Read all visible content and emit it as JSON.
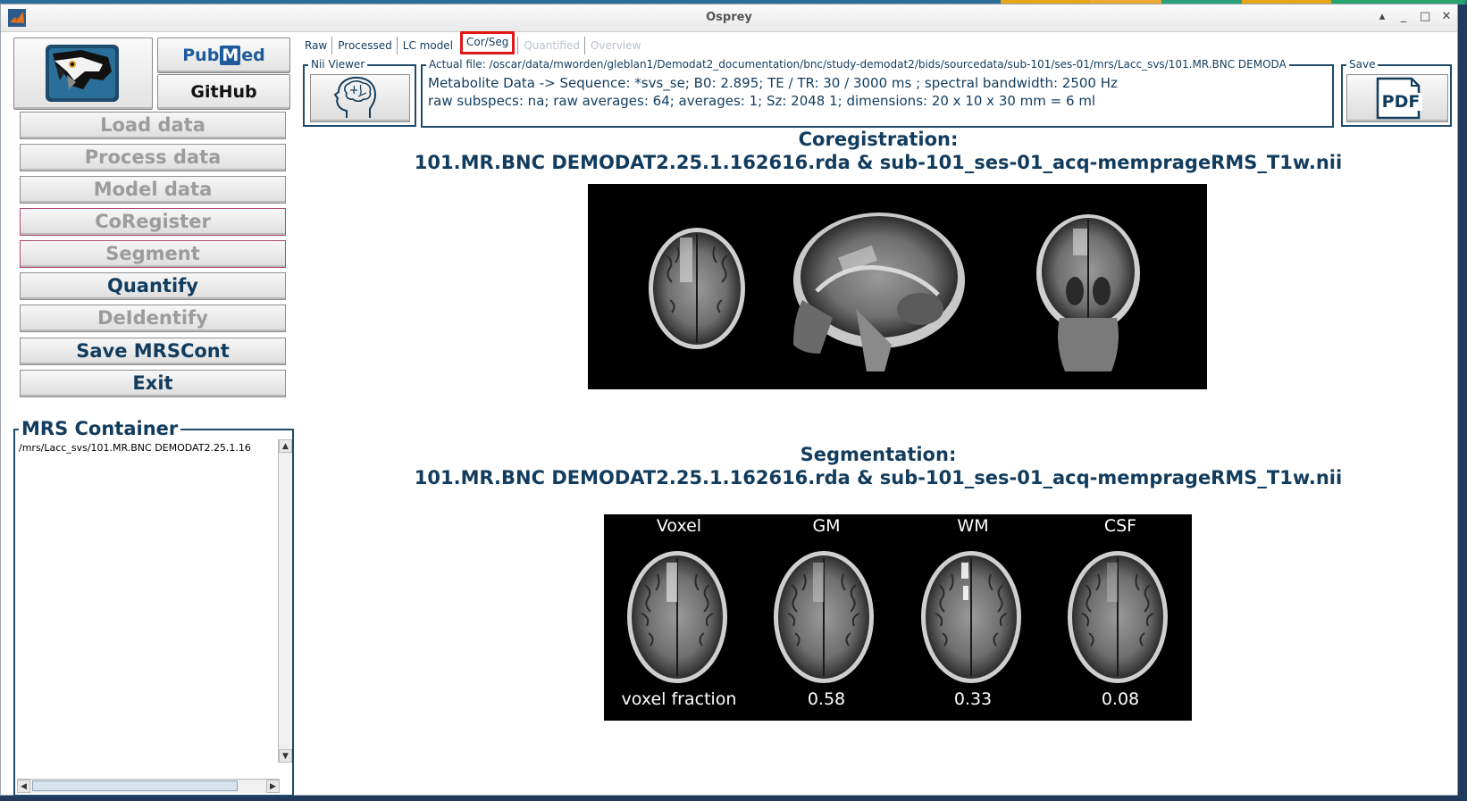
{
  "window": {
    "title": "Osprey",
    "controls": [
      "▴",
      "_",
      "□",
      "✕"
    ]
  },
  "links": {
    "pubmed_pre": "Pub",
    "pubmed_box": "M",
    "pubmed_post": "ed",
    "github": "GitHub"
  },
  "sidebar": {
    "buttons": [
      {
        "label": "Load data",
        "state": "disabled"
      },
      {
        "label": "Process data",
        "state": "disabled"
      },
      {
        "label": "Model data",
        "state": "disabled"
      },
      {
        "label": "CoRegister",
        "state": "disabled"
      },
      {
        "label": "Segment",
        "state": "disabled"
      },
      {
        "label": "Quantify",
        "state": "enabled"
      },
      {
        "label": "DeIdentify",
        "state": "disabled"
      },
      {
        "label": "Save MRSCont",
        "state": "enabled"
      },
      {
        "label": "Exit",
        "state": "enabled"
      }
    ],
    "mrs_container": {
      "title": "MRS Container",
      "items": [
        "/mrs/Lacc_svs/101.MR.BNC DEMODAT2.25.1.16"
      ]
    }
  },
  "tabs": [
    {
      "label": "Raw",
      "state": "normal"
    },
    {
      "label": "Processed",
      "state": "normal"
    },
    {
      "label": "LC model",
      "state": "normal"
    },
    {
      "label": "Cor/Seg",
      "state": "active"
    },
    {
      "label": "Quantified",
      "state": "dim"
    },
    {
      "label": "Overview",
      "state": "dim"
    }
  ],
  "nii_viewer": {
    "title": "Nii Viewer",
    "icon": "brain-head-icon"
  },
  "info": {
    "title": "Actual file: /oscar/data/mworden/gleblan1/Demodat2_documentation/bnc/study-demodat2/bids/sourcedata/sub-101/ses-01/mrs/Lacc_svs/101.MR.BNC DEMODA",
    "line1": "Metabolite Data -> Sequence:  *svs_se; B0: 2.895; TE / TR: 30 / 3000 ms ; spectral bandwidth: 2500 Hz",
    "line2": "raw subspecs: na; raw averages: 64; averages: 1; Sz: 2048     1; dimensions: 20 x 10 x 30 mm = 6 ml"
  },
  "save": {
    "title": "Save",
    "icon": "pdf-icon",
    "pdf_text": "PDF"
  },
  "coregistration": {
    "title": "Coregistration:",
    "subtitle": "101.MR.BNC DEMODAT2.25.1.162616.rda & sub-101_ses-01_acq-memprageRMS_T1w.nii"
  },
  "segmentation": {
    "title": "Segmentation:",
    "subtitle": "101.MR.BNC DEMODAT2.25.1.162616.rda & sub-101_ses-01_acq-memprageRMS_T1w.nii",
    "columns": [
      "Voxel",
      "GM",
      "WM",
      "CSF"
    ],
    "footer": [
      "voxel fraction",
      "0.58",
      "0.33",
      "0.08"
    ]
  },
  "colors": {
    "accent": "#123c5e",
    "active_tab_border": "#e01818",
    "disabled_text": "#9c9c9c"
  }
}
